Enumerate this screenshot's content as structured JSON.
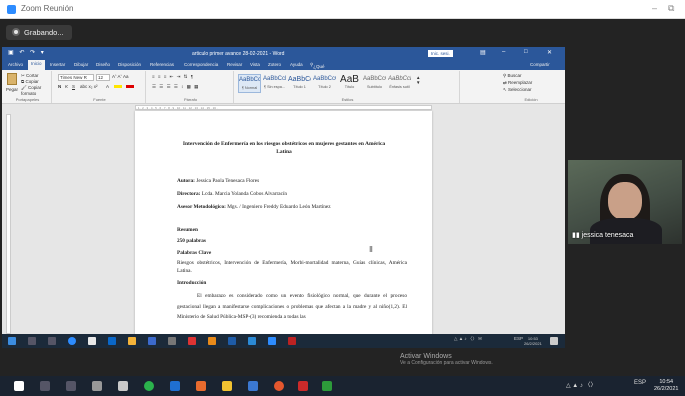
{
  "zoom": {
    "window_title": "Zoom Reunión",
    "recording_label": "Grabando...",
    "participant_name": "jessica tenesaca"
  },
  "word": {
    "doc_title": "articulo primer avance 28-02-2021 - Word",
    "signin_label": "Inic. sesi.",
    "tabs": [
      "Archivo",
      "Inicio",
      "Insertar",
      "Dibujar",
      "Diseño",
      "Disposición",
      "Referencias",
      "Correspondencia",
      "Revisar",
      "Vista",
      "Zotero",
      "Ayuda",
      "¿Qué desea hacer?",
      "Compartir"
    ],
    "ribbon": {
      "paste": "Pegar",
      "cut": "Cortar",
      "copy": "Copiar",
      "format_painter": "Copiar formato",
      "clipboard": "Portapapeles",
      "font_name": "Times New R",
      "font_size": "12",
      "font_group": "Fuente",
      "paragraph_group": "Párrafo",
      "styles_group": "Estilos",
      "editing_group": "Edición",
      "find": "Buscar",
      "replace": "Reemplazar",
      "select": "Seleccionar",
      "styles": [
        {
          "preview": "AaBbCcDc",
          "name": "¶ Normal"
        },
        {
          "preview": "AaBbCcDc",
          "name": "¶ Sin espa..."
        },
        {
          "preview": "AaBbCc",
          "name": "Título 1"
        },
        {
          "preview": "AaBbCcC",
          "name": "Título 2"
        },
        {
          "preview": "AaB",
          "name": "Título"
        },
        {
          "preview": "AaBbCcC",
          "name": "Subtítulo"
        },
        {
          "preview": "AaBbCcDc",
          "name": "Énfasis sutil"
        }
      ]
    },
    "document": {
      "title": "Intervención de Enfermería en los riesgos obstétricos en mujeres gestantes en América Latina",
      "author_label": "Autora:",
      "author": "Jessica Paola Tenesaca Flores",
      "director_label": "Directora:",
      "director": "Lcda. Marcia Yolanda Cobos Alvarracín",
      "advisor_label": "Asesor Metodológico:",
      "advisor": "Mgs. / Ingeniero Freddy Eduardo León Martínez",
      "resumen": "Resumen",
      "words": "250 palabras",
      "keywords_label": "Palabras Clave",
      "keywords": "Riesgos obstétricos, Intervención de Enfermería, Morbi-mortalidad materna, Guías clínicas, América Latina.",
      "intro": "Introducción",
      "intro_text": "El embarazo es considerado como un evento fisiológico normal, que durante el proceso gestacional llegan a manifestarse complicaciones o problemas que afectan a la madre y al niño(1,2). El Ministerio de Salud Pública-MSP-(3) recomienda a todas las"
    },
    "status": {
      "page": "Página 1 de 25",
      "words": "1665 palabras",
      "language": "Español (Ecuador)",
      "zoom": "100%"
    }
  },
  "windows_activation": {
    "title": "Activar Windows",
    "subtitle": "Ve a Configuración para activar Windows."
  },
  "inner_taskbar": {
    "lang": "ESP",
    "time": "10:53",
    "date": "26/2/2021"
  },
  "outer_taskbar": {
    "lang": "ESP",
    "time": "10:54",
    "date": "26/2/2021"
  }
}
